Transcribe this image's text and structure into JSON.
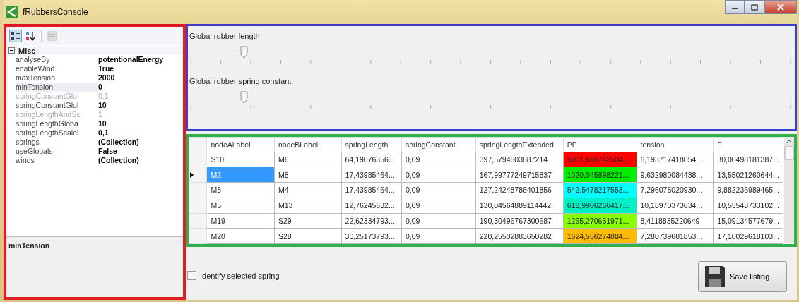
{
  "window": {
    "title": "fRubbersConsole"
  },
  "property_grid": {
    "category": {
      "label": "Misc",
      "expanded": true
    },
    "properties": [
      {
        "name": "analyseBy",
        "value": "potentionalEnergy",
        "disabled": false,
        "selected": false
      },
      {
        "name": "enableWind",
        "value": "True",
        "disabled": false,
        "selected": false
      },
      {
        "name": "maxTension",
        "value": "2000",
        "disabled": false,
        "selected": false
      },
      {
        "name": "minTension",
        "value": "0",
        "disabled": false,
        "selected": true
      },
      {
        "name": "springConstantGlol",
        "value": "0,1",
        "disabled": true,
        "selected": false
      },
      {
        "name": "springConstantGlol",
        "value": "10",
        "disabled": false,
        "selected": false
      },
      {
        "name": "springLengthAndSc",
        "value": "1",
        "disabled": true,
        "selected": false
      },
      {
        "name": "springLengthGloba",
        "value": "10",
        "disabled": false,
        "selected": false
      },
      {
        "name": "springLengthScalel",
        "value": "0,1",
        "disabled": false,
        "selected": false
      },
      {
        "name": "springs",
        "value": "(Collection)",
        "disabled": false,
        "selected": false
      },
      {
        "name": "useGlobals",
        "value": "False",
        "disabled": false,
        "selected": false
      },
      {
        "name": "winds",
        "value": "(Collection)",
        "disabled": false,
        "selected": false
      }
    ],
    "description": "minTension"
  },
  "sliders": [
    {
      "label": "Global rubber length",
      "level": 0.09
    },
    {
      "label": "Global rubber spring constant",
      "level": 0.09
    }
  ],
  "table": {
    "columns": [
      "nodeALabel",
      "nodeBLabel",
      "springLength",
      "springConstant",
      "springLengthExtended",
      "PE",
      "tension",
      "F"
    ],
    "rows": [
      {
        "selected": false,
        "color": "#ff0000",
        "cells": [
          "S10",
          "M6",
          "64,19076356...",
          "0,09",
          "397,5794503887214",
          "5001,660742504...",
          "6,193717418054...",
          "30,00498181387..."
        ]
      },
      {
        "selected": true,
        "color": "#00ee00",
        "cells": [
          "M2",
          "M8",
          "17,43985464...",
          "0,09",
          "167,99777249715837",
          "1020,045898221...",
          "9,632980084438...",
          "13,55021260644..."
        ]
      },
      {
        "selected": false,
        "color": "#00ffff",
        "cells": [
          "M8",
          "M4",
          "17,43985464...",
          "0,09",
          "127,24248786401856",
          "542,5478217553...",
          "7,296075020930...",
          "9,882236989465..."
        ]
      },
      {
        "selected": false,
        "color": "#00f0c8",
        "cells": [
          "M5",
          "M13",
          "12,76245632...",
          "0,09",
          "130,04564889114442",
          "618,9906266417...",
          "10,18970373634...",
          "10,55548733102..."
        ]
      },
      {
        "selected": false,
        "color": "#88ff00",
        "cells": [
          "M19",
          "S29",
          "22,62334793...",
          "0,09",
          "190,30496767300687",
          "1265,270651971...",
          "8,4118835220649",
          "15,09134577679..."
        ]
      },
      {
        "selected": false,
        "color": "#ffbb00",
        "cells": [
          "M20",
          "S28",
          "30,25173793...",
          "0,09",
          "220,25502883650282",
          "1624,556274884...",
          "7,280739681853...",
          "17,10029618103..."
        ]
      }
    ]
  },
  "checkbox": {
    "label": "Identify selected spring",
    "checked": false
  },
  "save_button": {
    "label": "Save listing"
  }
}
